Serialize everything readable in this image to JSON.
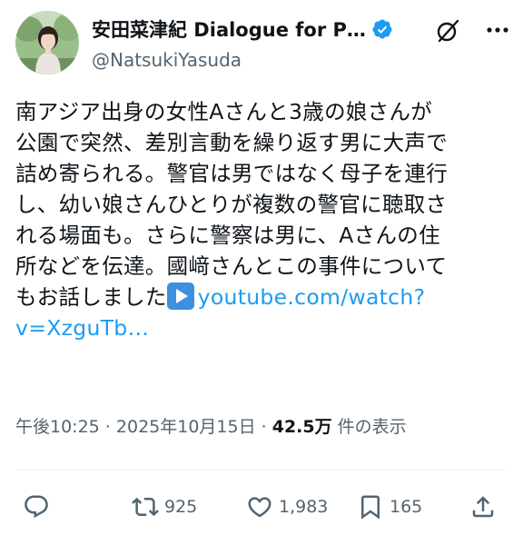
{
  "author": {
    "display_name": "安田菜津紀 Dialogue for P…",
    "handle": "@NatsukiYasuda"
  },
  "icons": [
    "avatar",
    "verified-badge-icon",
    "grok-icon",
    "more-icon",
    "reply-icon",
    "retweet-icon",
    "like-icon",
    "bookmark-icon",
    "share-icon"
  ],
  "colors": {
    "link": "#1d9bf0",
    "verified": "#1d9bf0",
    "secondary_text": "#536471"
  },
  "tweet": {
    "lines": [
      "南アジア出身の女性Aさんと3歳の娘さんが",
      "公園で突然、差別言動を繰り返す男に大声で",
      "詰め寄られる。警官は男ではなく母子を連行",
      "し、幼い娘さんひとりが複数の警官に聴取さ",
      "れる場面も。さらに警察は男に、Aさんの住",
      "所などを伝達。國﨑さんとこの事件について"
    ],
    "line7_text": "もお話しました",
    "link_part1": "youtube.com/watch?",
    "link_part2": "v=XzguTb…"
  },
  "meta": {
    "time": "午後10:25",
    "sep1": " · ",
    "date": "2025年10月15日",
    "sep2": " · ",
    "views": "42.5万",
    "views_label": " 件の表示"
  },
  "actions": {
    "retweets": "925",
    "likes": "1,983",
    "bookmarks": "165"
  }
}
